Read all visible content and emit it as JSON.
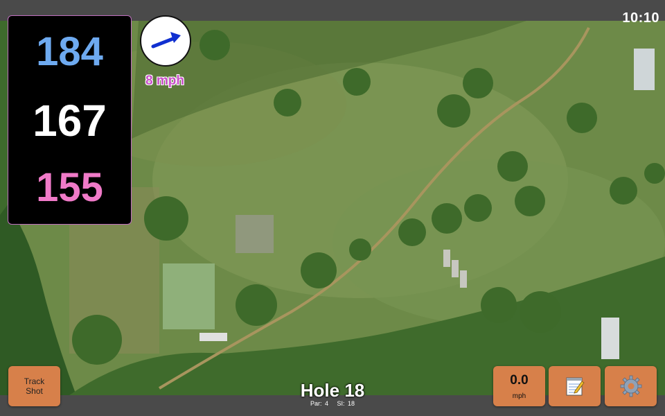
{
  "status": {
    "time": "10:10"
  },
  "distances": {
    "back": "184",
    "middle": "167",
    "front": "155"
  },
  "wind": {
    "speed": "8 mph",
    "icon": "wind-direction-arrow-icon"
  },
  "hole": {
    "title": "Hole 18",
    "par": "Par: 4",
    "si": "SI: 18"
  },
  "buttons": {
    "track_shot": [
      "Track",
      "Shot"
    ],
    "speed_value": "0.0",
    "speed_unit": "mph",
    "notes_icon": "notepad-icon",
    "settings_icon": "gear-icon"
  },
  "colors": {
    "back": "#6eaaf0",
    "middle": "#ffffff",
    "front": "#f07ac8",
    "wind_arrow": "#1030d0",
    "button_bg": "#d7804a",
    "panel_border": "#c070c0"
  }
}
